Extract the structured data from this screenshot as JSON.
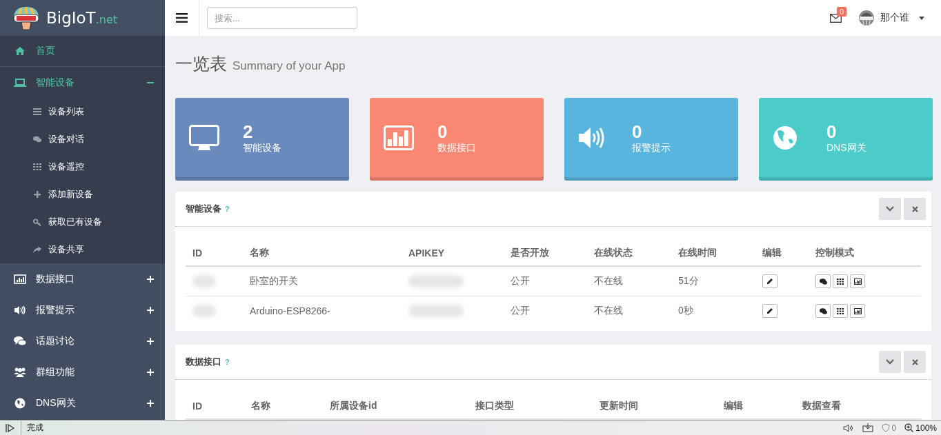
{
  "logo": {
    "name": "BigIoT",
    "suffix": ".net"
  },
  "header": {
    "search": {
      "placeholder": "搜索..."
    },
    "mail_count": "0",
    "user": "那个谁"
  },
  "sidebar": {
    "items": [
      {
        "label": "首页",
        "kind": "link",
        "selected": true
      },
      {
        "label": "智能设备",
        "kind": "group",
        "selected": true,
        "expanded": true,
        "children": [
          {
            "label": "设备列表",
            "selected": false
          },
          {
            "label": "设备对话",
            "selected": false
          },
          {
            "label": "设备遥控",
            "selected": false
          },
          {
            "label": "添加新设备",
            "selected": false
          },
          {
            "label": "获取已有设备",
            "selected": false
          },
          {
            "label": "设备共享",
            "selected": false
          }
        ]
      },
      {
        "label": "数据接口",
        "kind": "group",
        "selected": false,
        "expanded": false
      },
      {
        "label": "报警提示",
        "kind": "group",
        "selected": false,
        "expanded": false
      },
      {
        "label": "话题讨论",
        "kind": "group",
        "selected": false,
        "expanded": false
      },
      {
        "label": "群组功能",
        "kind": "group",
        "selected": false,
        "expanded": false
      },
      {
        "label": "DNS网关",
        "kind": "group",
        "selected": false,
        "expanded": false
      }
    ]
  },
  "page": {
    "title": "一览表",
    "subtitle": "Summary of your App"
  },
  "cards": [
    {
      "value": "2",
      "label": "智能设备",
      "color": "#6a8abe"
    },
    {
      "value": "0",
      "label": "数据接口",
      "color": "#fa8674"
    },
    {
      "value": "0",
      "label": "报警提示",
      "color": "#59b5de"
    },
    {
      "value": "0",
      "label": "DNS网关",
      "color": "#4ccbcb"
    }
  ],
  "panels": [
    {
      "title": "智能设备",
      "help": "?",
      "columns": [
        "ID",
        "名称",
        "APIKEY",
        "是否开放",
        "在线状态",
        "在线时间",
        "编辑",
        "控制模式"
      ],
      "rows": [
        {
          "name": "卧室的开关",
          "open": "公开",
          "status": "不在线",
          "time": "51分"
        },
        {
          "name": "Arduino-ESP8266-",
          "open": "公开",
          "status": "不在线",
          "time": "0秒"
        }
      ]
    },
    {
      "title": "数据接口",
      "help": "?",
      "columns": [
        "ID",
        "名称",
        "所属设备id",
        "接口类型",
        "更新时间",
        "编辑",
        "数据查看"
      ]
    }
  ],
  "status_bar": {
    "text": "完成",
    "blocked_count": "0",
    "zoom": "100%"
  }
}
